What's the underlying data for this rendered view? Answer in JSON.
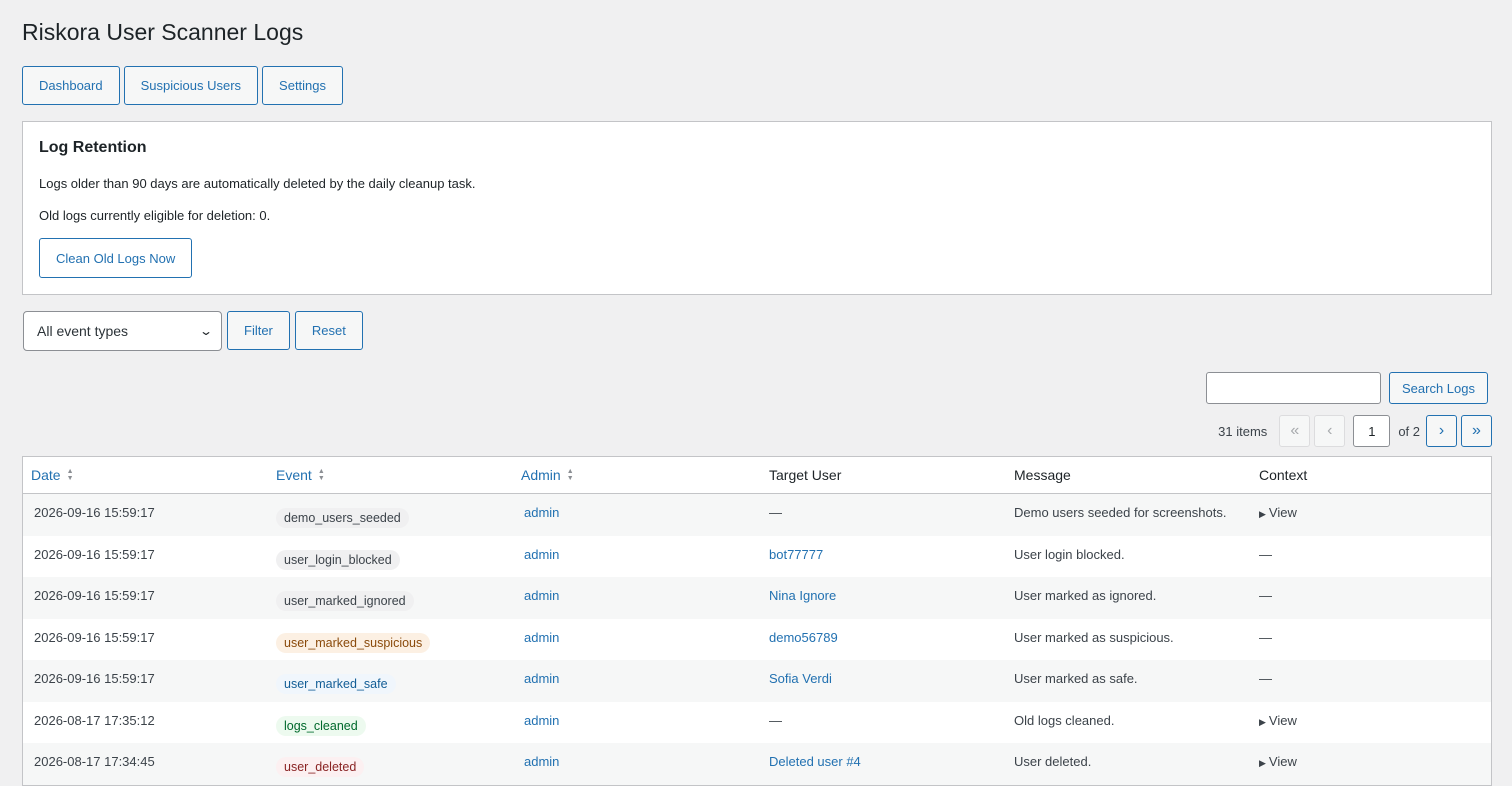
{
  "page_title": "Riskora User Scanner Logs",
  "nav": [
    {
      "label": "Dashboard"
    },
    {
      "label": "Suspicious Users"
    },
    {
      "label": "Settings"
    }
  ],
  "retention": {
    "heading": "Log Retention",
    "text1": "Logs older than 90 days are automatically deleted by the daily cleanup task.",
    "text2": "Old logs currently eligible for deletion: 0.",
    "clean_button": "Clean Old Logs Now"
  },
  "filters": {
    "select_value": "All event types",
    "filter_button": "Filter",
    "reset_button": "Reset"
  },
  "search": {
    "value": "",
    "button": "Search Logs"
  },
  "pagination": {
    "count": "31 items",
    "first": "«",
    "prev": "‹",
    "current": "1",
    "of_label": "of 2",
    "next": "›",
    "last": "»"
  },
  "table": {
    "columns": [
      "Date",
      "Event",
      "Admin",
      "Target User",
      "Message",
      "Context"
    ],
    "rows": [
      {
        "date": "2026-09-16 15:59:17",
        "event": "demo_users_seeded",
        "event_color": "gray",
        "admin": "admin",
        "target": "—",
        "message": "Demo users seeded for screenshots.",
        "context": "View"
      },
      {
        "date": "2026-09-16 15:59:17",
        "event": "user_login_blocked",
        "event_color": "gray",
        "admin": "admin",
        "target": "bot77777",
        "message": "User login blocked.",
        "context": "—"
      },
      {
        "date": "2026-09-16 15:59:17",
        "event": "user_marked_ignored",
        "event_color": "gray",
        "admin": "admin",
        "target": "Nina Ignore",
        "message": "User marked as ignored.",
        "context": "—"
      },
      {
        "date": "2026-09-16 15:59:17",
        "event": "user_marked_suspicious",
        "event_color": "orange",
        "admin": "admin",
        "target": "demo56789",
        "message": "User marked as suspicious.",
        "context": "—"
      },
      {
        "date": "2026-09-16 15:59:17",
        "event": "user_marked_safe",
        "event_color": "blue",
        "admin": "admin",
        "target": "Sofia Verdi",
        "message": "User marked as safe.",
        "context": "—"
      },
      {
        "date": "2026-08-17 17:35:12",
        "event": "logs_cleaned",
        "event_color": "green",
        "admin": "admin",
        "target": "—",
        "message": "Old logs cleaned.",
        "context": "View"
      },
      {
        "date": "2026-08-17 17:34:45",
        "event": "user_deleted",
        "event_color": "red",
        "admin": "admin",
        "target": "Deleted user #4",
        "message": "User deleted.",
        "context": "View"
      }
    ]
  },
  "colors": {
    "accent": "#2271b1",
    "background": "#f0f0f1"
  }
}
